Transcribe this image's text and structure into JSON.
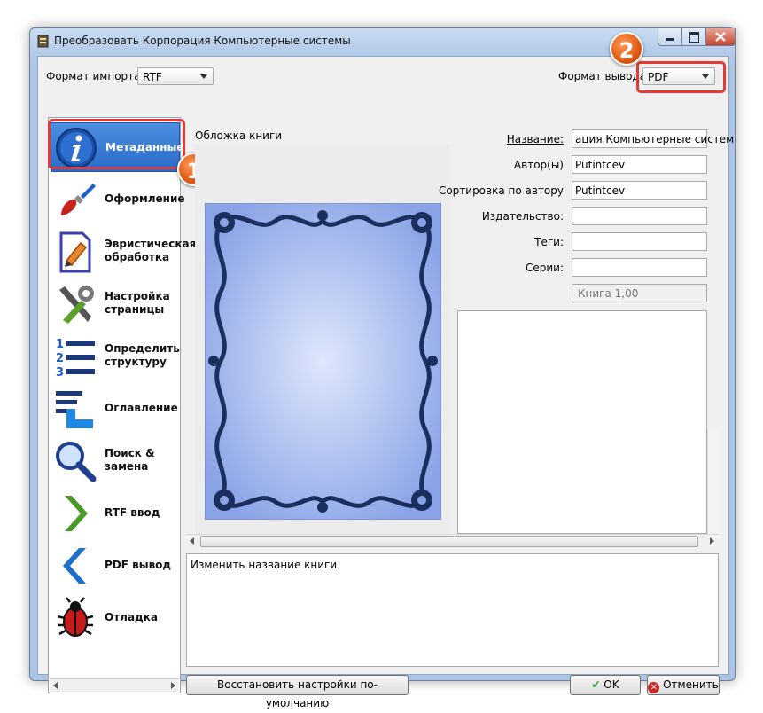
{
  "window": {
    "title": "Преобразовать Корпорация Компьютерные системы",
    "controls": {
      "min": "minimize-icon",
      "max": "maximize-icon",
      "close": "close-icon"
    }
  },
  "import_format": {
    "label": "Формат импорта:",
    "value": "RTF"
  },
  "output_format": {
    "label": "Формат вывода",
    "value": "PDF"
  },
  "sidebar": {
    "items": [
      {
        "label": "Метаданные",
        "icon": "info-icon"
      },
      {
        "label": "Оформление",
        "icon": "brush-icon"
      },
      {
        "label": "Эвристическая обработка",
        "icon": "document-edit-icon"
      },
      {
        "label": "Настройка страницы",
        "icon": "tools-icon"
      },
      {
        "label": "Определить структуру",
        "icon": "numbered-list-icon"
      },
      {
        "label": "Оглавление",
        "icon": "toc-icon"
      },
      {
        "label": "Поиск & замена",
        "icon": "search-icon"
      },
      {
        "label": "RTF ввод",
        "icon": "arrow-right-icon"
      },
      {
        "label": "PDF вывод",
        "icon": "arrow-left-icon"
      },
      {
        "label": "Отладка",
        "icon": "bug-icon"
      }
    ]
  },
  "cover": {
    "label": "Обложка книги"
  },
  "fields": {
    "title": {
      "label": "Название:",
      "value": "ация Компьютерные систем"
    },
    "author": {
      "label": "Автор(ы)",
      "value": "Putintcev"
    },
    "author_sort": {
      "label": "Сортировка по автору",
      "value": "Putintcev"
    },
    "publisher": {
      "label": "Издательство:",
      "value": ""
    },
    "tags": {
      "label": "Теги:",
      "value": ""
    },
    "series": {
      "label": "Серии:",
      "value": ""
    },
    "series_index": {
      "value": "Книга 1,00"
    }
  },
  "help": {
    "text": "Изменить название книги"
  },
  "buttons": {
    "restore": "Восстановить настройки по-умолчанию",
    "ok": "OK",
    "cancel": "Отменить"
  },
  "annotations": {
    "one": "1",
    "two": "2"
  },
  "colors": {
    "highlight": "#e53935",
    "badge": "#e05a12",
    "active": "#2a6bc9"
  }
}
